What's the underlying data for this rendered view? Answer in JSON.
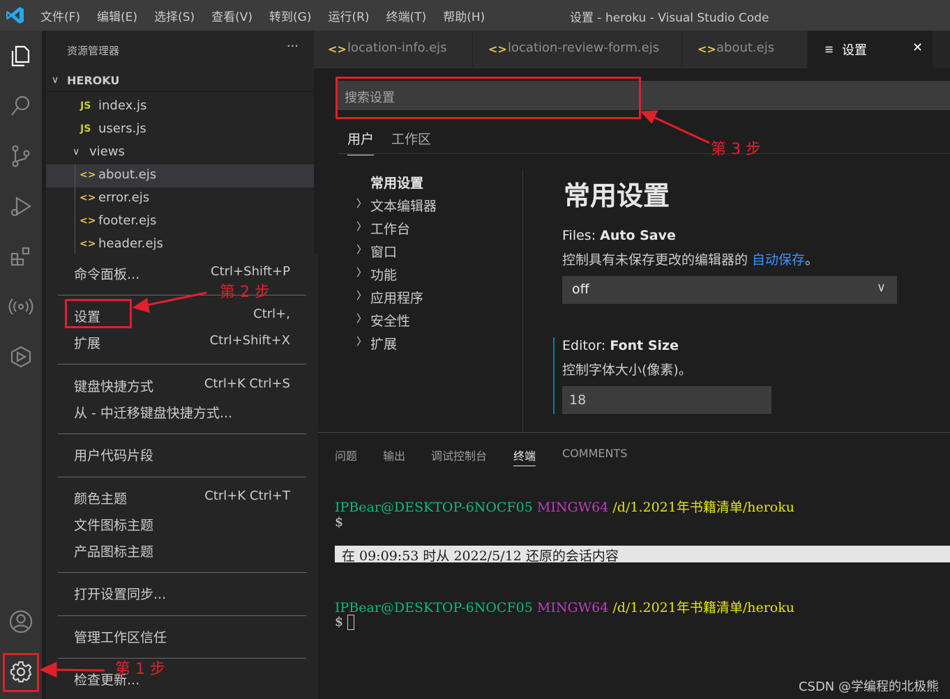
{
  "titlebar": {
    "menu": [
      "文件(F)",
      "编辑(E)",
      "选择(S)",
      "查看(V)",
      "转到(G)",
      "运行(R)",
      "终端(T)",
      "帮助(H)"
    ],
    "window_title": "设置 - heroku - Visual Studio Code"
  },
  "activity_bar": [
    "explorer-icon",
    "search-icon",
    "source-control-icon",
    "run-debug-icon",
    "extensions-icon",
    "remote-icon",
    "live-share-icon",
    "account-icon",
    "gear-icon"
  ],
  "sidebar": {
    "header": "资源管理器",
    "more": "···",
    "section": "HEROKU",
    "files": [
      {
        "icon": "JS",
        "name": "index.js"
      },
      {
        "icon": "JS",
        "name": "users.js"
      },
      {
        "icon": "folder",
        "name": "views"
      },
      {
        "icon": "<>",
        "name": "about.ejs"
      },
      {
        "icon": "<>",
        "name": "error.ejs"
      },
      {
        "icon": "<>",
        "name": "footer.ejs"
      },
      {
        "icon": "<>",
        "name": "header.ejs"
      }
    ]
  },
  "context_menu": {
    "items": [
      {
        "label": "命令面板...",
        "key": "Ctrl+Shift+P"
      },
      {
        "label": "设置",
        "key": "Ctrl+,"
      },
      {
        "label": "扩展",
        "key": "Ctrl+Shift+X"
      },
      {
        "label": "键盘快捷方式",
        "key": "Ctrl+K Ctrl+S"
      },
      {
        "label": "从 - 中迁移键盘快捷方式...",
        "key": ""
      },
      {
        "label": "用户代码片段",
        "key": ""
      },
      {
        "label": "颜色主题",
        "key": "Ctrl+K Ctrl+T"
      },
      {
        "label": "文件图标主题",
        "key": ""
      },
      {
        "label": "产品图标主题",
        "key": ""
      },
      {
        "label": "打开设置同步...",
        "key": ""
      },
      {
        "label": "管理工作区信任",
        "key": ""
      },
      {
        "label": "检查更新...",
        "key": ""
      }
    ]
  },
  "tabs": [
    {
      "icon": "<>",
      "label": "location-info.ejs"
    },
    {
      "icon": "<>",
      "label": "location-review-form.ejs"
    },
    {
      "icon": "<>",
      "label": "about.ejs"
    },
    {
      "icon": "≡",
      "label": "设置",
      "close": "✕"
    }
  ],
  "settings": {
    "search_placeholder": "搜索设置",
    "scope_tabs": [
      "用户",
      "工作区"
    ],
    "toc_head": "常用设置",
    "toc": [
      "文本编辑器",
      "工作台",
      "窗口",
      "功能",
      "应用程序",
      "安全性",
      "扩展"
    ],
    "section_title": "常用设置",
    "auto_save": {
      "category": "Files: ",
      "name": "Auto Save",
      "desc_prefix": "控制具有未保存更改的编辑器的 ",
      "desc_link": "自动保存",
      "desc_suffix": "。",
      "value": "off"
    },
    "font_size": {
      "category": "Editor: ",
      "name": "Font Size",
      "desc": "控制字体大小(像素)。",
      "value": "18"
    }
  },
  "panel": {
    "tabs": [
      "问题",
      "输出",
      "调试控制台",
      "终端",
      "COMMENTS"
    ],
    "terminal": {
      "user": "IPBear@DESKTOP-6NOCF05",
      "shell": "MINGW64",
      "path": "/d/1.2021年书籍清单/heroku",
      "prompt": "$",
      "restore_msg": "在 09:09:53 时从 2022/5/12 还原的会话内容"
    }
  },
  "annotations": {
    "step1": "第 1 步",
    "step2": "第 2 步",
    "step3": "第 3 步",
    "color": "#e0202a"
  },
  "watermark": "CSDN @学编程的北极熊"
}
